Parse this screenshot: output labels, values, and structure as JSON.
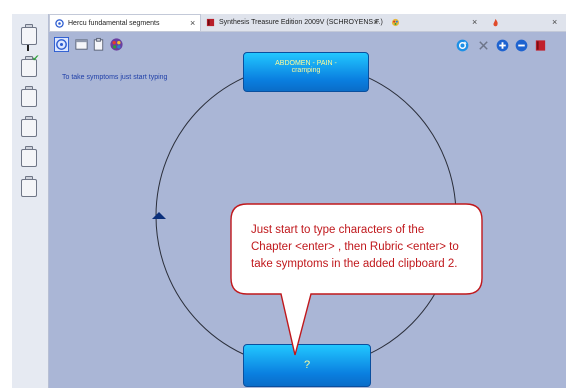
{
  "tabs": [
    {
      "label": "Hercu fundamental segments",
      "close": "×"
    },
    {
      "label": "Synthesis Treasure Edition 2009V (SCHROYENS F.)",
      "close": "×"
    },
    {
      "label": "",
      "close": "×"
    },
    {
      "label": "",
      "close": "×"
    }
  ],
  "hint": "To take symptoms just start typing",
  "rubric_top": {
    "line1": "ABDOMEN - PAIN -",
    "line2": "cramping"
  },
  "rubric_bottom": "?",
  "tooltip": {
    "line1": "Just start to type characters of the",
    "line2": "Chapter <enter> , then Rubric <enter>  to",
    "line3": "take symptoms in the added clipboard 2."
  },
  "icons": {
    "toolbar_left": [
      "target-icon",
      "window-icon",
      "clipboard-icon",
      "palette-icon"
    ],
    "toolbar_right": [
      "refresh-icon",
      "close-icon",
      "plus-icon",
      "minus-icon",
      "book-icon"
    ]
  },
  "colors": {
    "accent": "#0a7fe0",
    "tooltip_text": "#c0181c",
    "workspace": "#aab6d6"
  }
}
